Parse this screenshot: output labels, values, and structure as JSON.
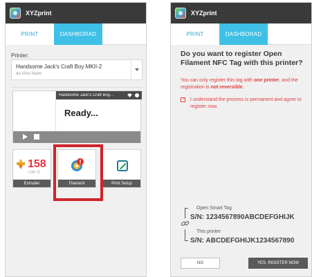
{
  "app": {
    "title": "XYZprint"
  },
  "tabs": {
    "print": "PRINT",
    "dashboard": "DASHBORAD"
  },
  "left": {
    "printer_label": "Printer:",
    "printer_name": "Handsome Jack's Craft Boy MKII-2",
    "printer_model": "da Vinci Nano",
    "status_header_name": "Handsome Jack's Craft Boy...",
    "status_text": "Ready...",
    "extruder_temp": "158",
    "extruder_unit": "/ 220 °C",
    "tiles": {
      "extruder": "Extruder",
      "filament": "Filament",
      "print_setup": "Print Setup"
    }
  },
  "right": {
    "question": "Do you want to register Open Filament NFC Tag with this printer?",
    "warning_prefix": "You can only register this tag with ",
    "warning_bold1": "one printer",
    "warning_middle": ", and the registration is ",
    "warning_bold2": "not reversible",
    "warning_suffix": ".",
    "consent_text": "I understand the process is permanent and agree to register now.",
    "tag_label": "Open Smart Tag",
    "tag_sn": "S/N: 1234567890ABCDEFGHIJK",
    "printer_label": "This printer",
    "printer_sn": "S/N: ABCDEFGHIJK1234567890",
    "btn_no": "NO",
    "btn_yes": "YES, RIGISTER NOW"
  },
  "colors": {
    "accent": "#3fc0e6",
    "tab_text": "#29a9d8",
    "titlebar": "#3a3a3a",
    "warning": "#e03a3a",
    "highlight": "#d0232b"
  }
}
